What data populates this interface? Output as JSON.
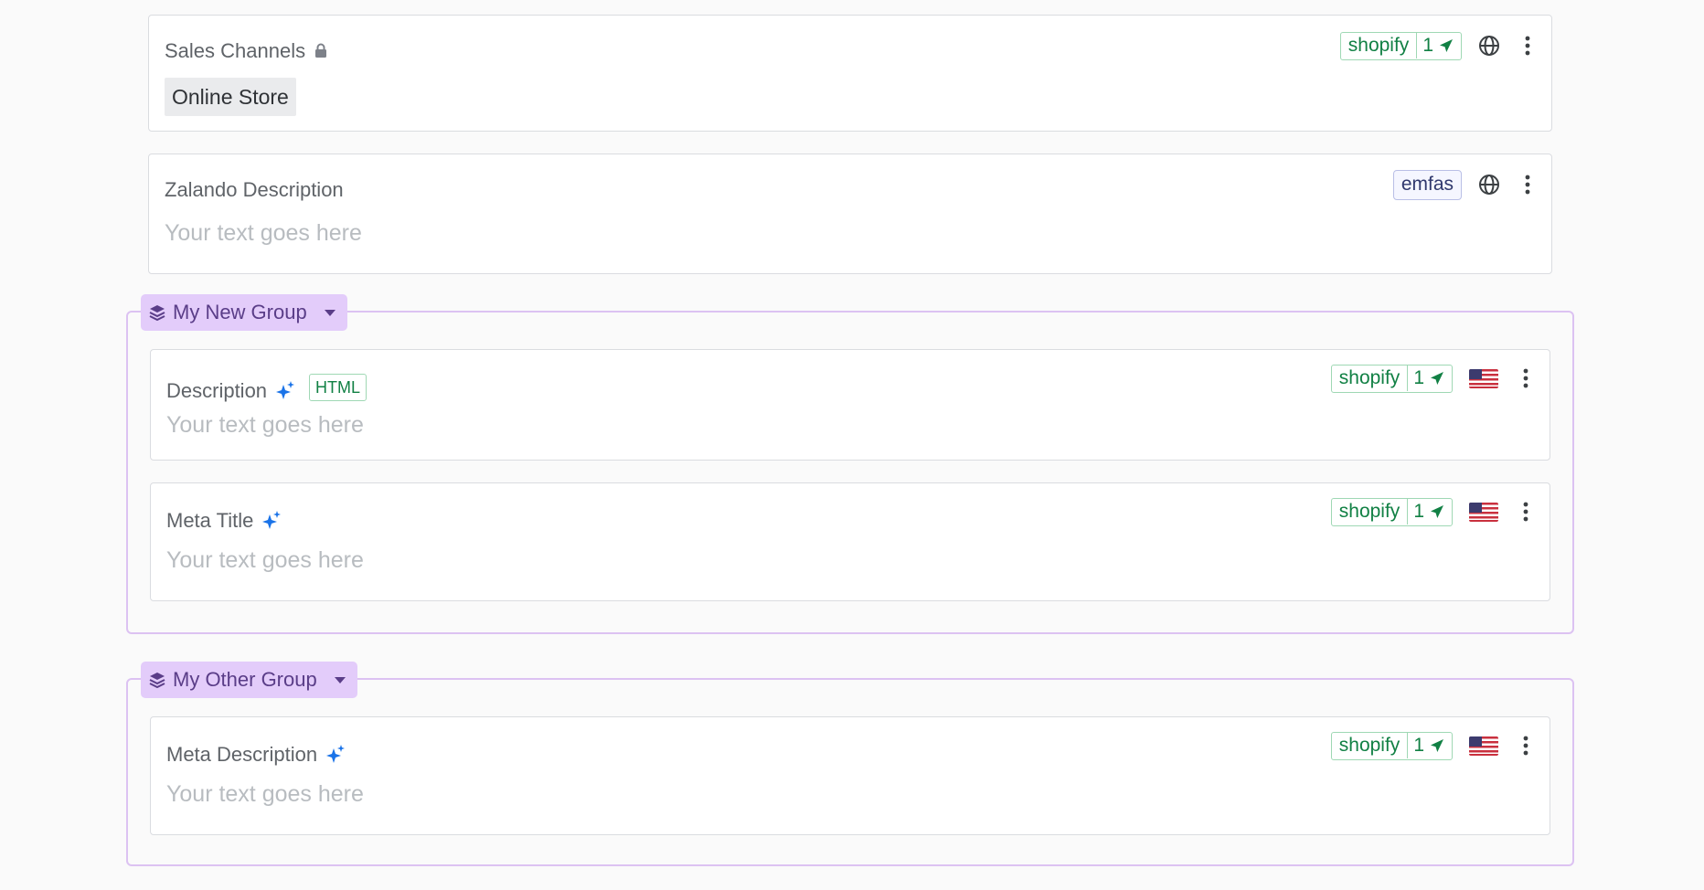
{
  "sales_channels": {
    "label": "Sales Channels",
    "chip": "Online Store",
    "badge_name": "shopify",
    "badge_count": "1"
  },
  "zalando": {
    "label": "Zalando Description",
    "placeholder": "Your text goes here",
    "badge": "emfas"
  },
  "group1": {
    "title": "My New Group",
    "fields": [
      {
        "label": "Description",
        "html_badge": "HTML",
        "placeholder": "Your text goes here",
        "badge_name": "shopify",
        "badge_count": "1"
      },
      {
        "label": "Meta Title",
        "placeholder": "Your text goes here",
        "badge_name": "shopify",
        "badge_count": "1"
      }
    ]
  },
  "group2": {
    "title": "My Other Group",
    "fields": [
      {
        "label": "Meta Description",
        "placeholder": "Your text goes here",
        "badge_name": "shopify",
        "badge_count": "1"
      }
    ]
  },
  "colors": {
    "accent_green": "#118044",
    "group_purple": "#e3ccfa",
    "sparkle_blue": "#1a73e8"
  },
  "icons": [
    "lock-icon",
    "globe-icon",
    "more-vert-icon",
    "send-icon",
    "sparkle-icon",
    "layers-icon",
    "caret-down-icon",
    "us-flag-icon"
  ]
}
